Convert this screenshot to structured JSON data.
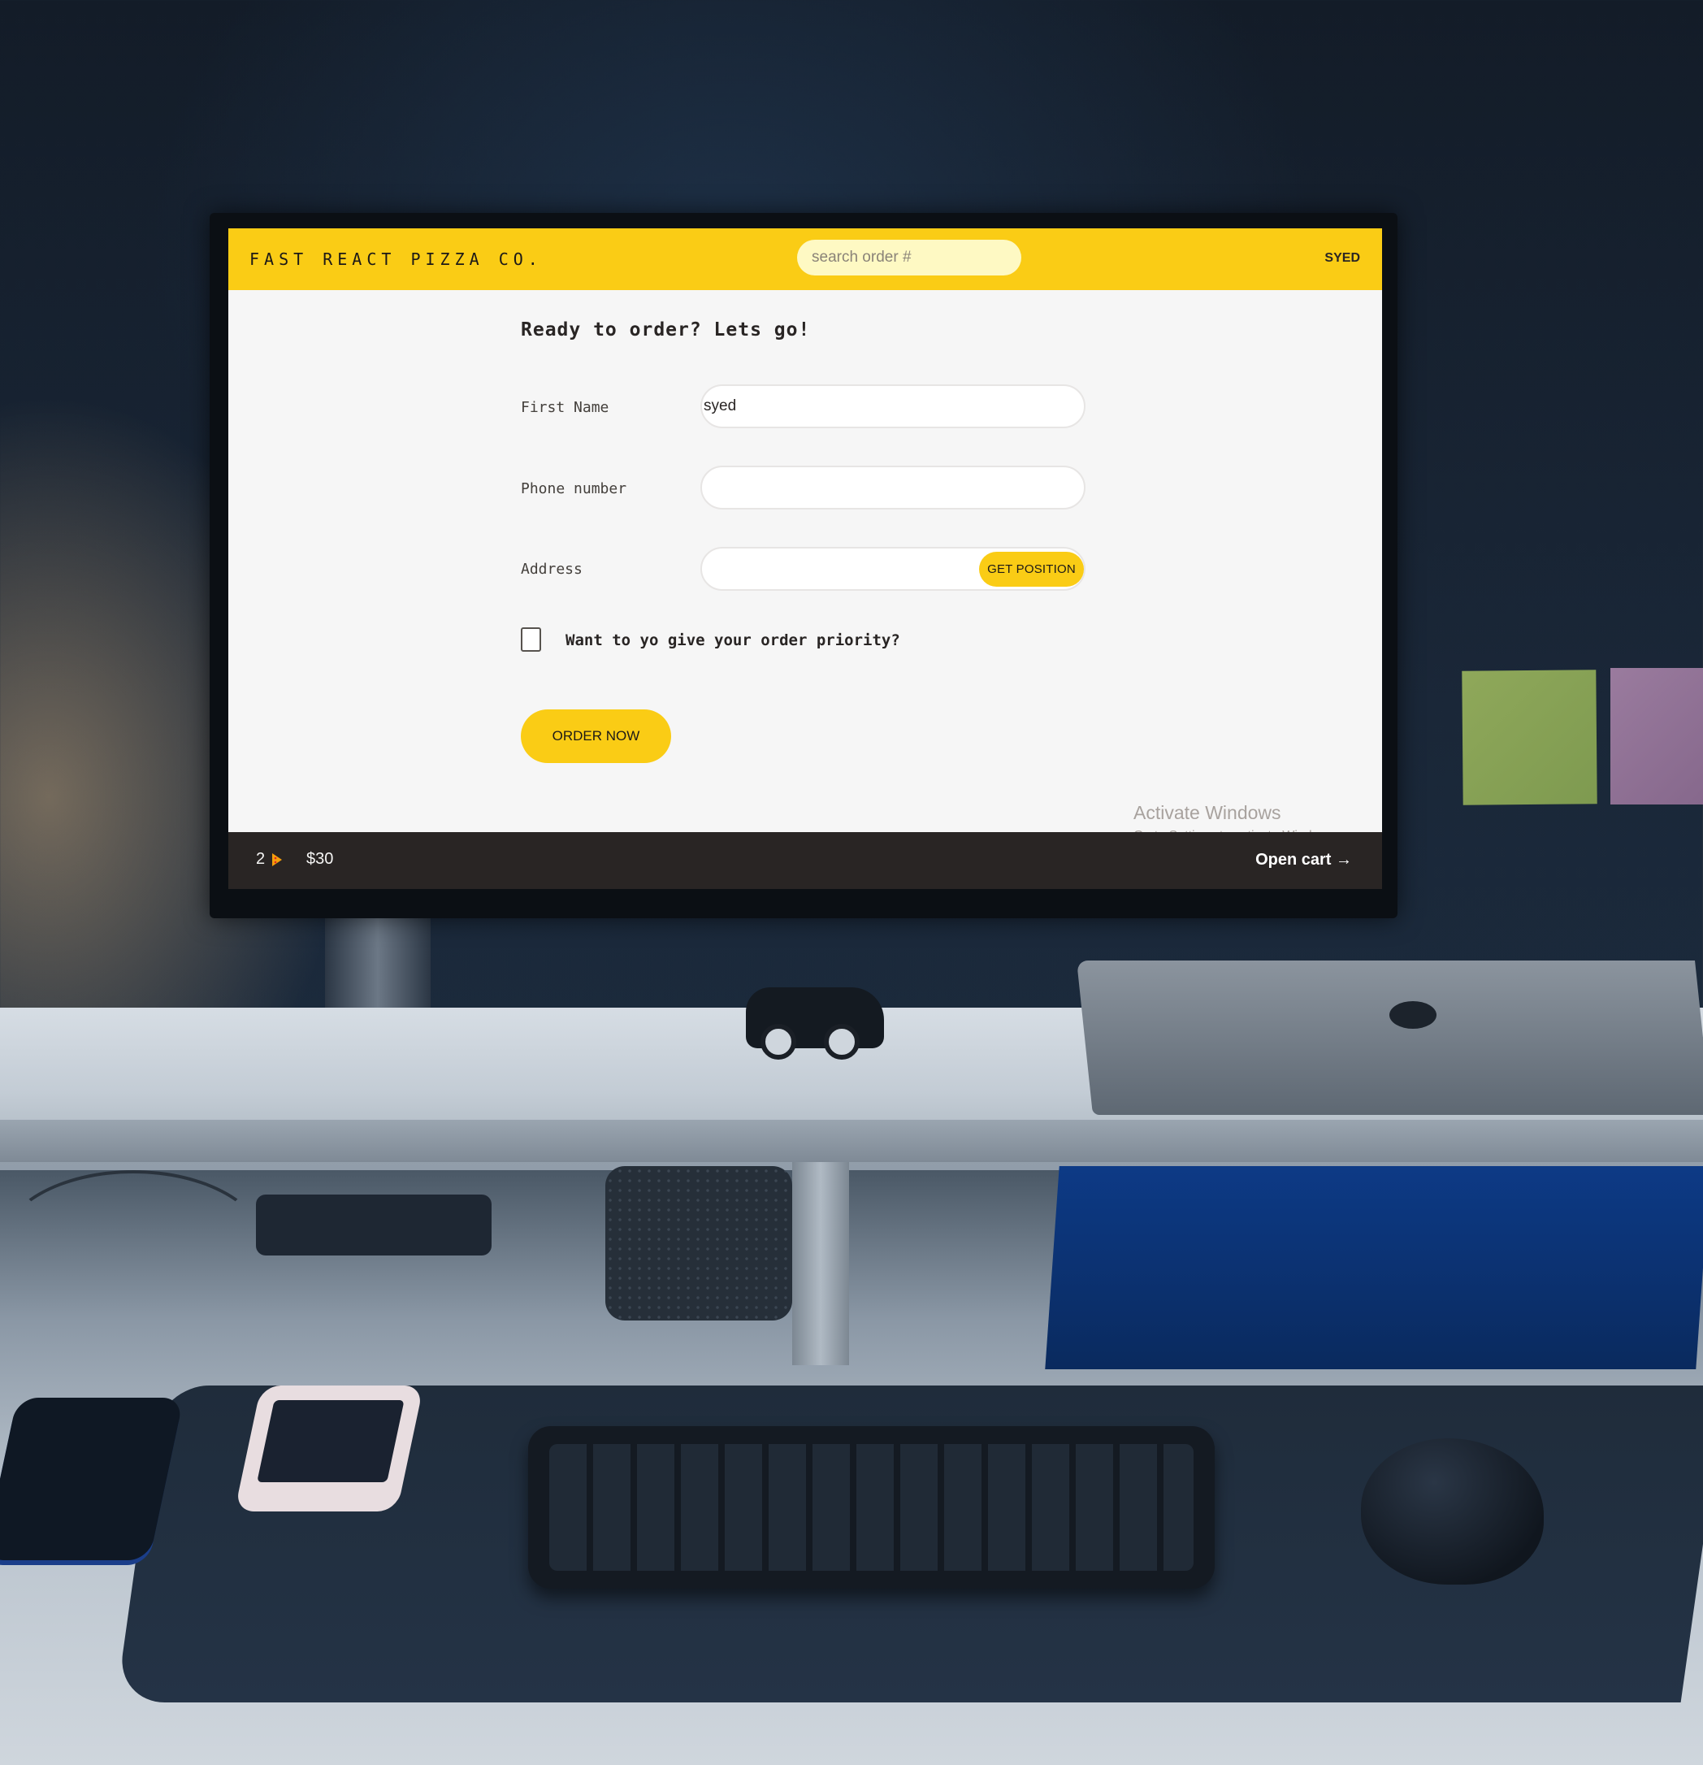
{
  "header": {
    "logo": "FAST REACT PIZZA CO.",
    "search_placeholder": "search order #",
    "username": "SYED"
  },
  "form": {
    "title": "Ready to order? Lets go!",
    "first_name_label": "First Name",
    "first_name_value": "syed",
    "phone_label": "Phone number",
    "phone_value": "",
    "address_label": "Address",
    "address_value": "",
    "get_position_label": "GET POSITION",
    "priority_label": "Want to yo give your order priority?",
    "priority_checked": false,
    "order_button_label": "ORDER NOW"
  },
  "watermark": {
    "title": "Activate Windows",
    "subtitle": "Go to Settings to activate Windows."
  },
  "cart": {
    "count": "2",
    "count_icon": "pizza-icon",
    "price": "$30",
    "open_label": "Open cart →"
  },
  "colors": {
    "accent": "#facc15",
    "search_bg": "#fef9c3",
    "cart_bar": "#292524",
    "page_bg": "#f6f6f6"
  }
}
